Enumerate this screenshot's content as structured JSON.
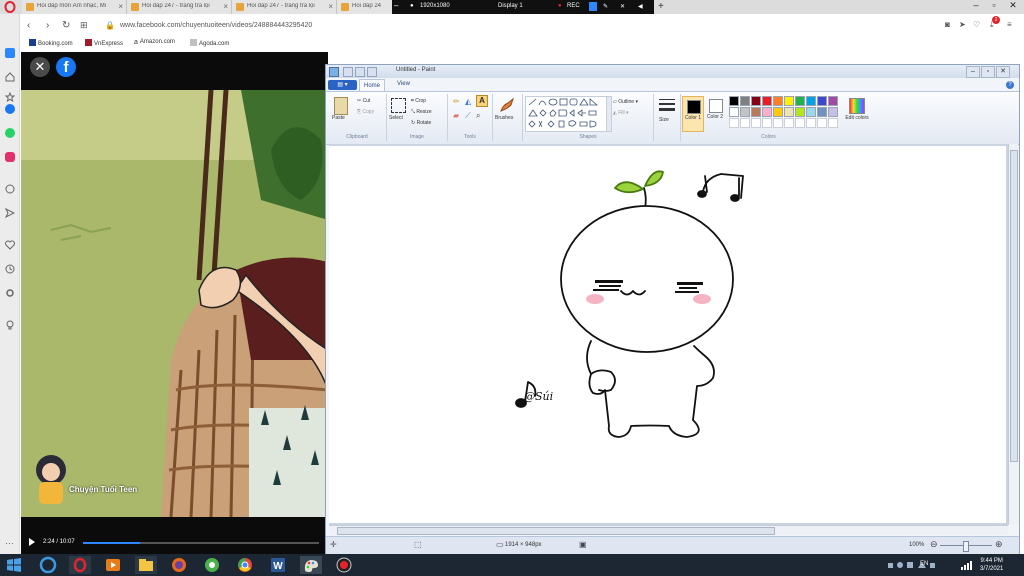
{
  "browser": {
    "tabs": [
      {
        "title": "Hỏi đáp môn Âm nhạc, Mĩ"
      },
      {
        "title": "Hỏi đáp 247 - trang tra lọi"
      },
      {
        "title": "Hỏi đáp 247 - trang tra lọi"
      },
      {
        "title": "Hỏi đáp 24"
      }
    ],
    "recorder": {
      "resolution": "1920x1080",
      "display": "Display 1",
      "rec_label": "REC"
    },
    "url": "www.facebook.com/chuyentuoiteen/videos/248884443295420",
    "bookmarks": [
      "Booking.com",
      "VnExpress",
      "Amazon.com",
      "Agoda.com"
    ],
    "notification_count": "2"
  },
  "video": {
    "channel_name": "Chuyện Tuổi Teen",
    "time": "2:24 / 10:07",
    "progress": 0.24
  },
  "paint": {
    "title": "Untitled - Paint",
    "tabs": {
      "home": "Home",
      "view": "View"
    },
    "clipboard": {
      "paste": "Paste",
      "cut": "Cut",
      "copy": "Copy",
      "group": "Clipboard"
    },
    "image": {
      "select": "Select",
      "crop": "Crop",
      "resize": "Resize",
      "rotate": "Rotate",
      "group": "Image"
    },
    "tools": {
      "group": "Tools",
      "brushes": "Brushes"
    },
    "shapes": {
      "outline": "Outline",
      "fill": "Fill",
      "group": "Shapes"
    },
    "size_label": "Size",
    "color1": "Color 1",
    "color2": "Color 2",
    "colors_group": "Colors",
    "edit_colors": "Edit colors",
    "palette": [
      "#000000",
      "#7f7f7f",
      "#880015",
      "#ed1c24",
      "#ff7f27",
      "#fff200",
      "#22b14c",
      "#00a2e8",
      "#3f48cc",
      "#a349a4",
      "#ffffff",
      "#c3c3c3",
      "#b97a57",
      "#ffaec9",
      "#ffc90e",
      "#efe4b0",
      "#b5e61d",
      "#99d9ea",
      "#7092be",
      "#c8bfe7"
    ],
    "drawing": {
      "signature": "@Súi"
    },
    "status_size": "1914 × 948px",
    "zoom": "100%"
  },
  "taskbar": {
    "lang": "EN",
    "time": "9:44 PM",
    "date": "3/7/2021"
  }
}
